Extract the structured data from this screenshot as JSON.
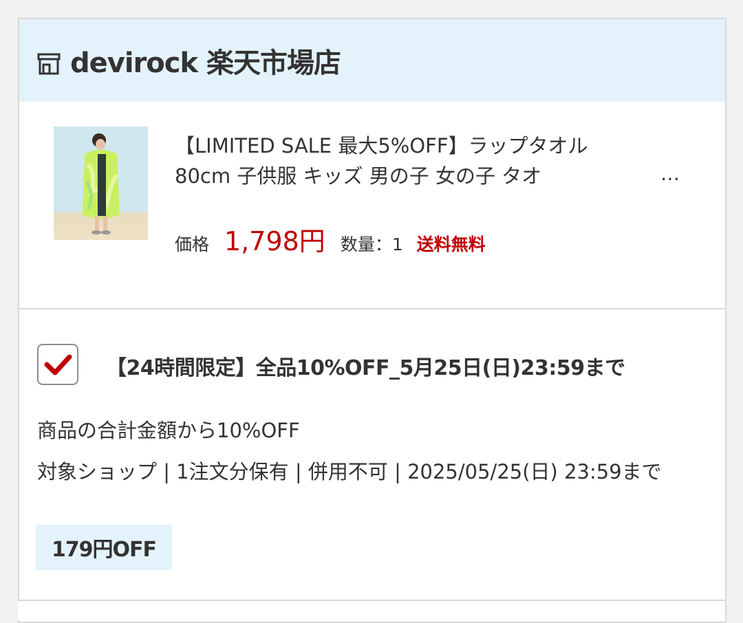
{
  "shop": {
    "name": "devirock 楽天市場店",
    "icon": "shop-icon"
  },
  "product": {
    "title": "【LIMITED SALE 最大5%OFF】ラップタオル 80cm 子供服 キッズ 男の子 女の子 タオ",
    "ellipsis": "…",
    "price_label": "価格",
    "price": "1,798円",
    "quantity": "数量：1",
    "shipping": "送料無料",
    "thumbnail_alt": "product-photo"
  },
  "coupon": {
    "checked": true,
    "title": "【24時間限定】全品10%OFF_5月25日(日)23:59まで",
    "description": "商品の合計金額から10%OFF",
    "conditions": "対象ショップ | 1注文分保有 | 併用不可 | 2025/05/25(日) 23:59まで",
    "discount": "179円OFF"
  },
  "colors": {
    "accent_red": "#bf0000",
    "header_bg": "#e4f3fb",
    "border": "#d9d9d9"
  }
}
